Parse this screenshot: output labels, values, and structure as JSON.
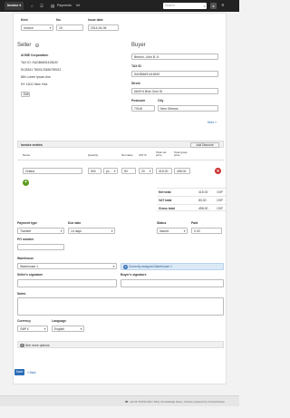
{
  "topbar": {
    "brand": "Invoice",
    "home_icon": "home-icon",
    "nav_label": "Payments",
    "nav_extra": "inf",
    "search_placeholder": "Search",
    "search_icon": "search-icon",
    "user_icon": "user-icon",
    "menu_icon": "menu-icon"
  },
  "invoice": {
    "kind_label": "Kind",
    "kind_value": "Invoice",
    "no_label": "No.",
    "no_value": "15",
    "issue_date_label": "Issue date",
    "issue_date_value": "2014-04-06"
  },
  "seller": {
    "title": "Seller",
    "lines": [
      "ACME Corporation",
      "TAX ID: SAGB6691415632",
      "5125341 T600123456789012",
      "884 Lorem Ipsum Ave",
      "NY 11111 New York"
    ],
    "edit_label": "Edit"
  },
  "buyer": {
    "title": "Buyer",
    "name_value": "Benton, John B Jr",
    "tax_id_label": "TAX ID",
    "tax_id_value": "SAGB6691415632",
    "street_label": "Street",
    "street_value": "6649 N Blue Gum St",
    "postcode_label": "Postcode",
    "postcode_value": "70116",
    "city_label": "City",
    "city_value": "New Orleans",
    "more_link": "More »"
  },
  "entries": {
    "title": "Invoice entries",
    "add_discount": "Add Discount",
    "col_name": "Name",
    "col_quantity": "Quantity",
    "col_net_value": "Net value",
    "col_vat": "VAT %",
    "col_total_net": "Total net price",
    "col_total_gross": "Total gross price",
    "row": {
      "name": "Oriana",
      "quantity": "500",
      "unit": "pc...",
      "net_value": "83",
      "vat": "20",
      "total_net": "415.00",
      "total_gross": "498.00"
    },
    "remove_icon": "remove-icon",
    "add_icon": "plus-icon"
  },
  "totals": {
    "net_label": "Net total",
    "net_value": "415.00",
    "vat_label": "VAT total",
    "vat_value": "83.00",
    "gross_label": "Gross total",
    "gross_value": "498.00",
    "currency": "GBP"
  },
  "payment": {
    "type_label": "Payment type",
    "type_value": "Transfer",
    "due_label": "Due date",
    "due_value": "14 days",
    "status_label": "Status",
    "status_value": "Issued",
    "paid_label": "Paid",
    "paid_value": "0.00",
    "po_label": "PO number",
    "po_value": ""
  },
  "warehouse": {
    "label": "Warehouse",
    "value": "Warehouse 1",
    "info": "Currently assigned Warehouse 1",
    "info_icon": "info-icon"
  },
  "signatures": {
    "seller_label": "Seller's signature",
    "buyer_label": "Buyer's signature"
  },
  "notes": {
    "label": "Notes"
  },
  "settings": {
    "currency_label": "Currency",
    "currency_value": "GBP £",
    "language_label": "Language",
    "language_value": "English",
    "more_options": "See more options",
    "more_icon": "chevron-down-icon"
  },
  "actions": {
    "save": "Save",
    "back": "« Back"
  },
  "footer": {
    "text": "☎ +44 20 79 834 202 / FAQ | Knowledge base | Invoice powered by InvoiceOcean"
  }
}
